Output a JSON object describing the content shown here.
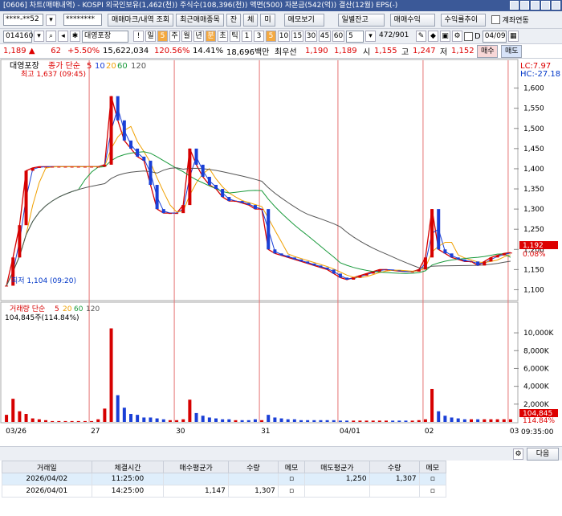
{
  "window": {
    "title": "[0606] 차트(매매내역) - KOSPI 외국인보유(1,462(천)) 주식수(108,396(천)) 액면(500) 자본금(542(억)) 결산(12월) EPS(-)"
  },
  "toolbar1": {
    "account": "****-**52",
    "password": "********",
    "btn_mark": "매매마크/내역 조회",
    "btn_recent": "최근매매종목",
    "btn_jan": "잔",
    "btn_me": "체",
    "btn_mi": "미",
    "btn_memo": "메모보기",
    "btn_daily": "일별잔고",
    "btn_profit": "매매수익",
    "btn_trend": "수익률추이",
    "chk_account": "계좌연동"
  },
  "toolbar2": {
    "code": "014160",
    "name": "대영포장",
    "periods": [
      "일",
      "주",
      "월",
      "년",
      "분",
      "초",
      "틱"
    ],
    "nums": [
      "1",
      "3",
      "5",
      "10",
      "15",
      "30",
      "45",
      "60"
    ],
    "active_num": "5",
    "count_sel": "5",
    "range": "472/901",
    "date": "04/09",
    "d_label": "D"
  },
  "info": {
    "price": "1,189",
    "arrow": "▲",
    "diff": "62",
    "pct": "+5.50%",
    "volume": "15,622,034",
    "vol_pct": "120.56%",
    "turnover": "14.41%",
    "amount": "18,696백만",
    "best": "최우선",
    "ask": "1,190",
    "bid": "1,189",
    "open_lbl": "시",
    "open": "1,155",
    "high_lbl": "고",
    "high": "1,247",
    "low_lbl": "저",
    "low": "1,152",
    "buy_btn": "매수",
    "sell_btn": "매도"
  },
  "chart_data": {
    "type": "line",
    "title": "대영포장",
    "legend": {
      "price": "종가 단순",
      "ma": [
        "5",
        "10",
        "20",
        "60",
        "120"
      ],
      "volume": "거래량 단순",
      "vma": [
        "5",
        "20",
        "60",
        "120"
      ]
    },
    "ma_colors": [
      "#d60000",
      "#1a3fd6",
      "#f0a000",
      "#1a9a3c",
      "#555555"
    ],
    "annotations": {
      "high": "최고 1,637 (09:45)",
      "low": "최저 1,104 (09:20)",
      "lc": "LC:7.97",
      "hc": "HC:-27.18",
      "vol_text": "104,845주(114.84%)",
      "cur_price": "1,192",
      "cur_pct": "0.08%",
      "cur_vol": "104,845",
      "cur_vol_pct": "114.84%"
    },
    "price_axis": [
      "1,600",
      "1,550",
      "1,500",
      "1,450",
      "1,400",
      "1,350",
      "1,300",
      "1,250",
      "1,200",
      "1,150",
      "1,100"
    ],
    "price_ylim": [
      1075,
      1665
    ],
    "vol_axis": [
      "10,000K",
      "8,000K",
      "6,000K",
      "4,000K",
      "2,000K"
    ],
    "vol_ylim": [
      0,
      11000
    ],
    "date_labels": [
      "03/26",
      "27",
      "30",
      "31",
      "04/01",
      "02",
      "03"
    ],
    "time_end": "09:35:00",
    "close_series": [
      1110,
      1180,
      1260,
      1395,
      1402,
      1405,
      1405,
      1405,
      1405,
      1405,
      1405,
      1405,
      1405,
      1405,
      1405,
      1410,
      1580,
      1520,
      1470,
      1450,
      1430,
      1420,
      1360,
      1300,
      1290,
      1290,
      1290,
      1310,
      1450,
      1410,
      1380,
      1360,
      1350,
      1330,
      1320,
      1320,
      1315,
      1310,
      1300,
      1300,
      1200,
      1190,
      1185,
      1180,
      1175,
      1170,
      1165,
      1160,
      1155,
      1150,
      1140,
      1130,
      1125,
      1130,
      1135,
      1140,
      1145,
      1150,
      1150,
      1148,
      1146,
      1145,
      1145,
      1150,
      1180,
      1300,
      1200,
      1190,
      1180,
      1175,
      1170,
      1170,
      1160,
      1170,
      1180,
      1185,
      1190,
      1192
    ],
    "vol_series": [
      800,
      2600,
      1200,
      900,
      400,
      300,
      200,
      100,
      100,
      100,
      100,
      100,
      100,
      100,
      300,
      1500,
      10500,
      3000,
      1600,
      900,
      800,
      500,
      500,
      400,
      300,
      200,
      200,
      300,
      2500,
      1000,
      700,
      500,
      400,
      300,
      300,
      200,
      200,
      200,
      300,
      200,
      800,
      500,
      400,
      300,
      300,
      200,
      200,
      200,
      200,
      200,
      200,
      150,
      150,
      150,
      150,
      150,
      150,
      150,
      150,
      150,
      150,
      150,
      150,
      200,
      300,
      3700,
      1200,
      700,
      500,
      400,
      300,
      300,
      300,
      300,
      300,
      300,
      300,
      300
    ],
    "vol_highlight": "104,845"
  },
  "bottombar": {
    "next": "다음"
  },
  "table": {
    "headers": [
      "거래일",
      "체결시간",
      "매수평균가",
      "수량",
      "메모",
      "매도평균가",
      "수량",
      "메모"
    ],
    "rows": [
      [
        "2026/04/02",
        "11:25:00",
        "",
        "",
        "",
        "1,250",
        "1,307",
        ""
      ],
      [
        "2026/04/01",
        "14:25:00",
        "1,147",
        "1,307",
        "",
        "",
        "",
        ""
      ]
    ]
  }
}
